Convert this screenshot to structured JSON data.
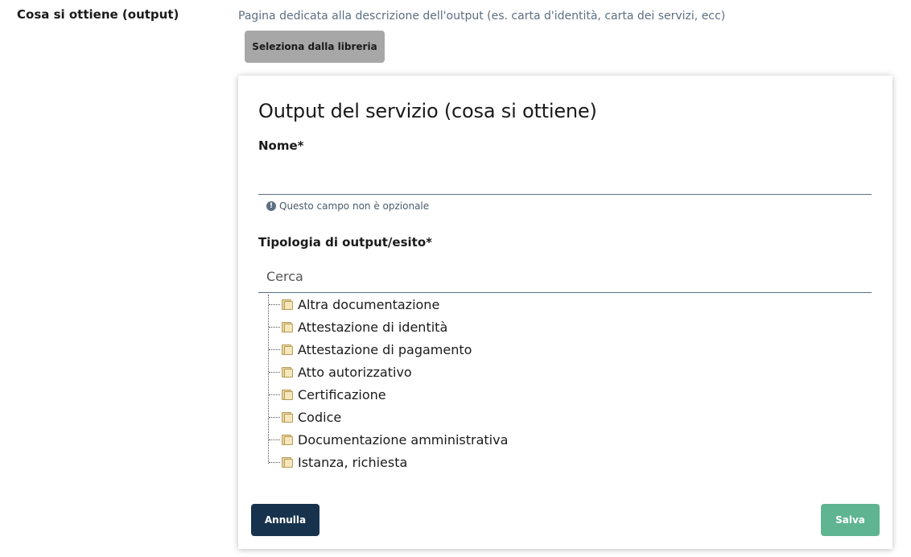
{
  "field": {
    "label": "Cosa si ottiene (output)",
    "help": "Pagina dedicata alla descrizione dell'output (es. carta d'identità, carta dei servizi, ecc)",
    "library_button": "Seleziona dalla libreria"
  },
  "modal": {
    "title": "Output del servizio (cosa si ottiene)",
    "nome_label": "Nome*",
    "nome_value": "",
    "validation_message": "Questo campo non è opzionale",
    "validation_icon": "exclamation-circle-icon",
    "tipologia_label": "Tipologia di output/esito*",
    "search_placeholder": "Cerca",
    "tree_items": [
      {
        "label": "Altra documentazione",
        "icon": "folder-icon"
      },
      {
        "label": "Attestazione di identità",
        "icon": "folder-icon"
      },
      {
        "label": "Attestazione di pagamento",
        "icon": "folder-icon"
      },
      {
        "label": "Atto autorizzativo",
        "icon": "folder-icon"
      },
      {
        "label": "Certificazione",
        "icon": "folder-icon"
      },
      {
        "label": "Codice",
        "icon": "folder-icon"
      },
      {
        "label": "Documentazione amministrativa",
        "icon": "folder-icon"
      },
      {
        "label": "Istanza, richiesta",
        "icon": "folder-icon"
      }
    ],
    "cancel_button": "Annulla",
    "save_button": "Salva"
  },
  "colors": {
    "primary_dark": "#17324d",
    "save_green": "#5fb492",
    "library_gray": "#a7a7a7",
    "help_text": "#5b6f82"
  }
}
